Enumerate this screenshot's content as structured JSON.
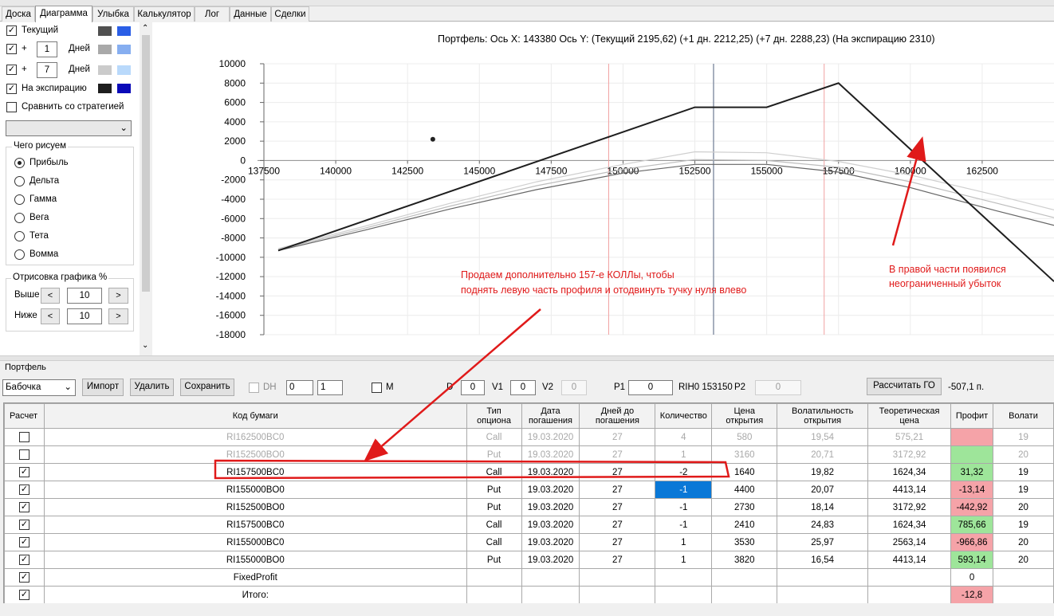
{
  "tabs": [
    {
      "label": "Доска",
      "active": false
    },
    {
      "label": "Диаграмма",
      "active": true
    },
    {
      "label": "Улыбка",
      "active": false
    },
    {
      "label": "Калькулятор",
      "active": false
    },
    {
      "label": "Лог",
      "active": false
    },
    {
      "label": "Данные",
      "active": false
    },
    {
      "label": "Сделки",
      "active": false
    }
  ],
  "left": {
    "current_label": "Текущий",
    "plus_label": "+",
    "days_label": "Дней",
    "days1": "1",
    "days2": "7",
    "expiry_label": "На экспирацию",
    "compare_label": "Сравнить со стратегией",
    "group_title": "Чего рисуем",
    "radios": [
      "Прибыль",
      "Дельта",
      "Гамма",
      "Вега",
      "Тета",
      "Вомма"
    ],
    "selected_radio": "Прибыль",
    "draw_title": "Отрисовка графика %",
    "above_label": "Выше",
    "below_label": "Ниже",
    "above_value": "10",
    "below_value": "10",
    "dec": "<",
    "inc": ">",
    "swatch_colors": {
      "current": [
        "#505050",
        "#2a5ee6"
      ],
      "day1": [
        "#a9a9a9",
        "#86aef0"
      ],
      "day7": [
        "#cbcbcb",
        "#b9d9fb"
      ],
      "expiry": [
        "#1e1e1e",
        "#0a0ab8"
      ]
    }
  },
  "chart": {
    "header": "Портфель: Ось X: 143380 Ось Y:  (Текущий 2195,62)  (+1 дн. 2212,25)  (+7 дн. 2288,23)  (На экспирацию 2310)",
    "annotation1_line1": "Продаем дополнительно 157-е КОЛЛы, чтобы",
    "annotation1_line2": "поднять левую часть профиля и отодвинуть тучку нуля влево",
    "annotation2_line1": "В правой части появился",
    "annotation2_line2": "неограниченный убыток",
    "annotation_color": "#e01a1a"
  },
  "chart_data": {
    "type": "line",
    "xlim": [
      137500,
      165000
    ],
    "ylim": [
      -18000,
      10000
    ],
    "x_ticks": [
      137500,
      140000,
      142500,
      145000,
      147500,
      150000,
      152500,
      155000,
      157500,
      160000,
      162500
    ],
    "y_ticks": [
      10000,
      8000,
      6000,
      4000,
      2000,
      0,
      -2000,
      -4000,
      -6000,
      -8000,
      -10000,
      -12000,
      -14000,
      -16000,
      -18000
    ],
    "series": [
      {
        "color": "#1e1e1e",
        "points": [
          [
            138000,
            -9300
          ],
          [
            152500,
            5500
          ],
          [
            155000,
            5500
          ],
          [
            157500,
            8000
          ],
          [
            165000,
            -12500
          ]
        ]
      },
      {
        "color": "#666666",
        "points": [
          [
            138000,
            -9300
          ],
          [
            141000,
            -7200
          ],
          [
            144000,
            -5000
          ],
          [
            147000,
            -3000
          ],
          [
            150000,
            -1300
          ],
          [
            152500,
            -400
          ],
          [
            155000,
            -400
          ],
          [
            157500,
            -1200
          ],
          [
            160000,
            -2800
          ],
          [
            163000,
            -5200
          ],
          [
            165000,
            -6700
          ]
        ]
      },
      {
        "color": "#cfcfcf",
        "points": [
          [
            138000,
            -9100
          ],
          [
            141000,
            -6800
          ],
          [
            144000,
            -4400
          ],
          [
            147000,
            -2200
          ],
          [
            150000,
            -400
          ],
          [
            152500,
            900
          ],
          [
            155000,
            800
          ],
          [
            157500,
            -100
          ],
          [
            160000,
            -1500
          ],
          [
            163000,
            -3600
          ],
          [
            165000,
            -5100
          ]
        ]
      },
      {
        "color": "#bdbdbd",
        "points": [
          [
            138000,
            -9200
          ],
          [
            141000,
            -7000
          ],
          [
            144000,
            -4700
          ],
          [
            147000,
            -2600
          ],
          [
            150000,
            -900
          ],
          [
            152500,
            100
          ],
          [
            155000,
            0
          ],
          [
            157500,
            -700
          ],
          [
            160000,
            -2200
          ],
          [
            163000,
            -4400
          ],
          [
            165000,
            -5900
          ]
        ]
      }
    ],
    "marker_point": [
      143380,
      2200
    ],
    "current_price_x": 153150,
    "bound_lines_x": [
      149500,
      157000
    ]
  },
  "portfolio": {
    "title": "Портфель",
    "strategy": "Бабочка",
    "import": "Импорт",
    "delete": "Удалить",
    "save": "Сохранить",
    "dh": "DH",
    "spin1": "0",
    "spin2": "1",
    "m": "M",
    "d_label": "D",
    "d_value": "0",
    "v1_label": "V1",
    "v1_value": "0",
    "v2_label": "V2",
    "v2_value": "0",
    "p1_label": "P1",
    "p1_value": "0",
    "rih": "RIH0 153150",
    "p2_label": "P2",
    "p2_value": "0",
    "calc_go": "Рассчитать ГО",
    "go_value": "-507,1 п."
  },
  "table": {
    "headers": [
      "Расчет",
      "Код бумаги",
      "Тип\nопциона",
      "Дата\nпогашения",
      "Дней до\nпогашения",
      "Количество",
      "Цена\nоткрытия",
      "Волатильность\nоткрытия",
      "Теоретическая\nцена",
      "Профит",
      "Волати"
    ],
    "rows": [
      {
        "checked": false,
        "dim": true,
        "cells": [
          "RI162500BC0",
          "Call",
          "19.03.2020",
          "27",
          "4",
          "580",
          "19,54",
          "575,21",
          "",
          "19"
        ],
        "profit_class": "neg"
      },
      {
        "checked": false,
        "dim": true,
        "cells": [
          "RI152500BO0",
          "Put",
          "19.03.2020",
          "27",
          "1",
          "3160",
          "20,71",
          "3172,92",
          "",
          "20"
        ],
        "profit_class": "pos"
      },
      {
        "checked": true,
        "dim": false,
        "cells": [
          "RI157500BC0",
          "Call",
          "19.03.2020",
          "27",
          "-2",
          "1640",
          "19,82",
          "1624,34",
          "31,32",
          "19"
        ],
        "profit_class": "pos"
      },
      {
        "checked": true,
        "dim": false,
        "cells": [
          "RI155000BO0",
          "Put",
          "19.03.2020",
          "27",
          "-1",
          "4400",
          "20,07",
          "4413,14",
          "-13,14",
          "19"
        ],
        "profit_class": "neg",
        "selected_qty": true
      },
      {
        "checked": true,
        "dim": false,
        "cells": [
          "RI152500BO0",
          "Put",
          "19.03.2020",
          "27",
          "-1",
          "2730",
          "18,14",
          "3172,92",
          "-442,92",
          "20"
        ],
        "profit_class": "neg"
      },
      {
        "checked": true,
        "dim": false,
        "cells": [
          "RI157500BC0",
          "Call",
          "19.03.2020",
          "27",
          "-1",
          "2410",
          "24,83",
          "1624,34",
          "785,66",
          "19"
        ],
        "profit_class": "pos"
      },
      {
        "checked": true,
        "dim": false,
        "cells": [
          "RI155000BC0",
          "Call",
          "19.03.2020",
          "27",
          "1",
          "3530",
          "25,97",
          "2563,14",
          "-966,86",
          "20"
        ],
        "profit_class": "neg"
      },
      {
        "checked": true,
        "dim": false,
        "cells": [
          "RI155000BO0",
          "Put",
          "19.03.2020",
          "27",
          "1",
          "3820",
          "16,54",
          "4413,14",
          "593,14",
          "20"
        ],
        "profit_class": "pos"
      },
      {
        "checked": true,
        "dim": false,
        "cells": [
          "FixedProfit",
          "",
          "",
          "",
          "",
          "",
          "",
          "",
          "0",
          ""
        ],
        "profit_class": ""
      },
      {
        "checked": true,
        "dim": false,
        "cells": [
          "Итого:",
          "",
          "",
          "",
          "",
          "",
          "",
          "",
          "-12,8",
          ""
        ],
        "profit_class": "neg"
      }
    ]
  }
}
